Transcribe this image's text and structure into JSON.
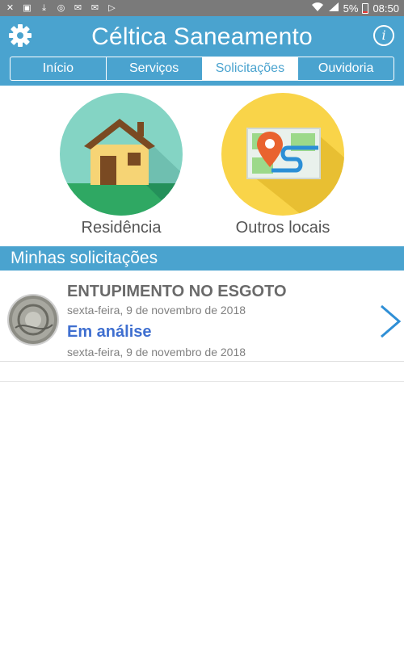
{
  "status_bar": {
    "left_icons": [
      "tools-icon",
      "image-icon",
      "download-icon",
      "cast-icon",
      "mail-icon",
      "mail-icon",
      "play-store-icon"
    ],
    "battery": "5%",
    "time": "08:50"
  },
  "header": {
    "title": "Céltica Saneamento",
    "info_glyph": "i"
  },
  "tabs": [
    {
      "label": "Início",
      "active": false
    },
    {
      "label": "Serviços",
      "active": false
    },
    {
      "label": "Solicitações",
      "active": true
    },
    {
      "label": "Ouvidoria",
      "active": false
    }
  ],
  "categories": [
    {
      "label": "Residência",
      "icon": "house-icon"
    },
    {
      "label": "Outros locais",
      "icon": "map-pin-icon"
    }
  ],
  "section_title": "Minhas solicitações",
  "requests": [
    {
      "title": "ENTUPIMENTO NO ESGOTO",
      "date_created": "sexta-feira, 9 de novembro de 2018",
      "status": "Em análise",
      "date_status": "sexta-feira, 9 de novembro de 2018"
    }
  ],
  "colors": {
    "primary": "#4aa3cf",
    "status": "#3f6fd0",
    "house_bg": "#84d4c4",
    "map_bg": "#f9d449"
  }
}
